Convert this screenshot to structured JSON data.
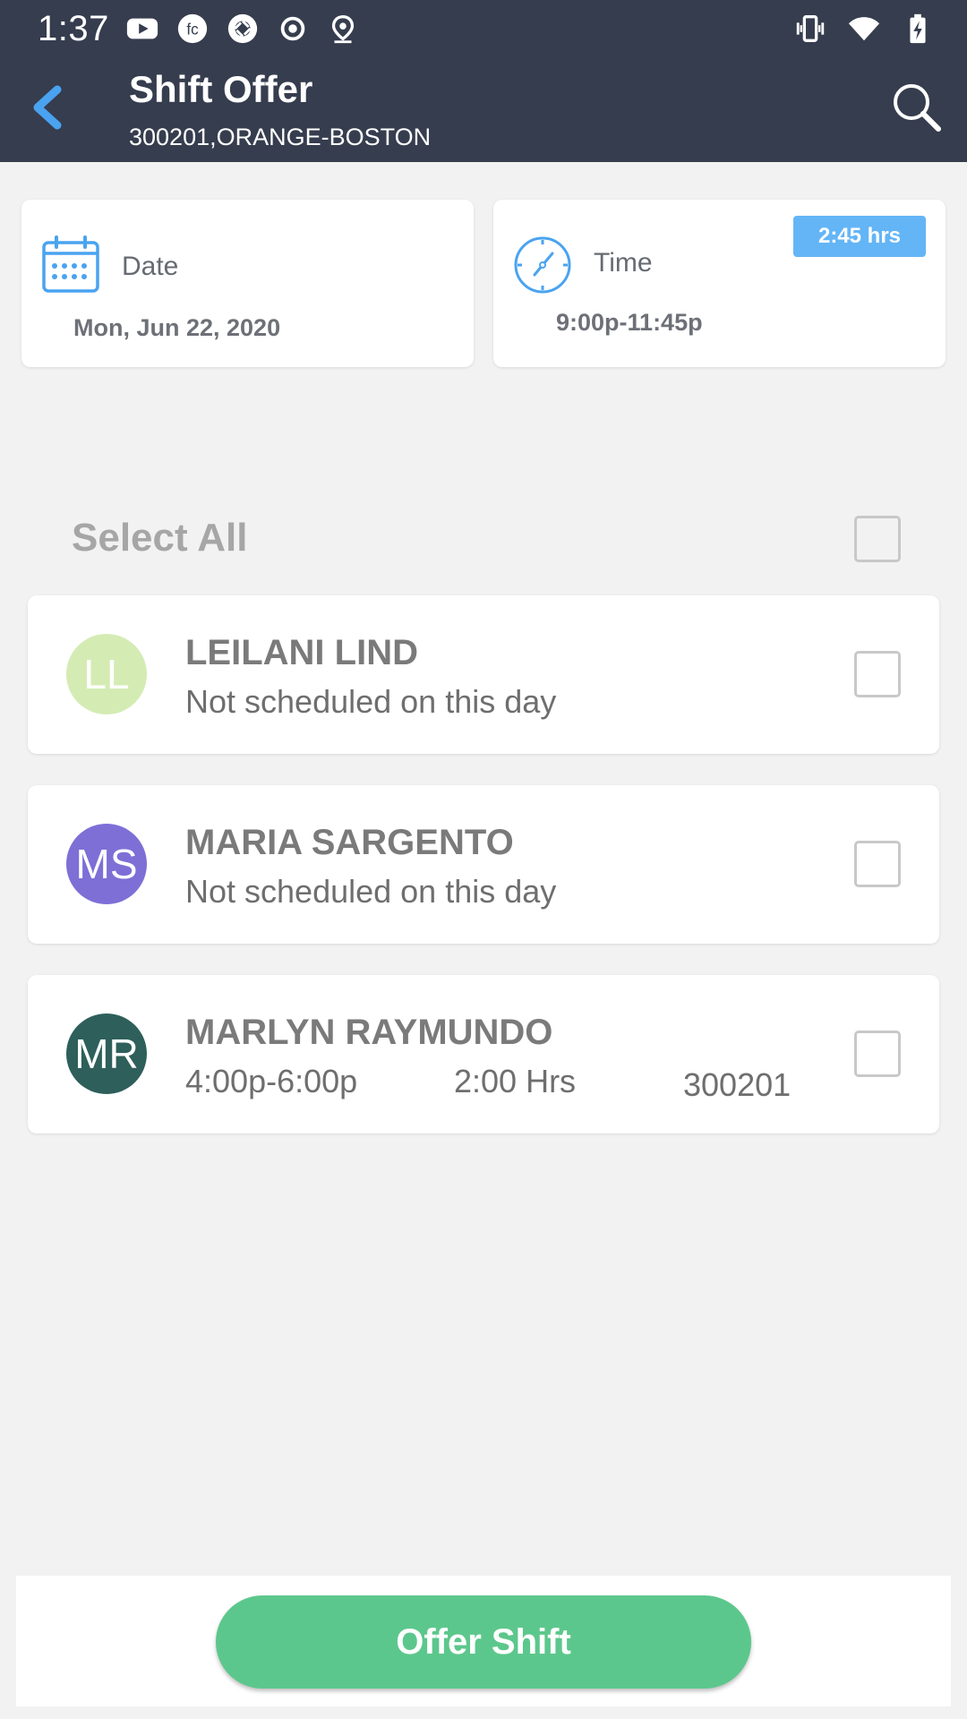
{
  "status_bar": {
    "time": "1:37",
    "left_icons": [
      "youtube-icon",
      "fc-app-icon",
      "camera-shutter-icon",
      "record-icon",
      "location-icon"
    ],
    "right_icons": [
      "vibrate-icon",
      "wifi-icon",
      "battery-charging-icon"
    ]
  },
  "appbar": {
    "title": "Shift Offer",
    "subtitle": "300201,ORANGE-BOSTON",
    "back_icon": "chevron-left-icon",
    "search_icon": "search-icon",
    "background": "#363d4e",
    "accent": "#4aa3f0"
  },
  "date_card": {
    "label": "Date",
    "value": "Mon, Jun 22, 2020",
    "icon": "calendar-icon"
  },
  "time_card": {
    "label": "Time",
    "value": "9:00p-11:45p",
    "badge": "2:45 hrs",
    "icon": "clock-icon"
  },
  "select_all": {
    "label": "Select All",
    "checked": false
  },
  "employees": [
    {
      "initials": "LL",
      "name": "LEILANI LIND",
      "status": "Not scheduled on this day",
      "avatar_color": "#d4ecb4",
      "checked": false
    },
    {
      "initials": "MS",
      "name": "MARIA SARGENTO",
      "status": "Not scheduled on this day",
      "avatar_color": "#7d6fd6",
      "checked": false
    },
    {
      "initials": "MR",
      "name": "MARLYN RAYMUNDO",
      "time_range": "4:00p-6:00p",
      "hours": "2:00 Hrs",
      "location": "300201",
      "avatar_color": "#2e5f5b",
      "checked": false
    }
  ],
  "offer_button": {
    "label": "Offer Shift",
    "color": "#5cc78c"
  }
}
